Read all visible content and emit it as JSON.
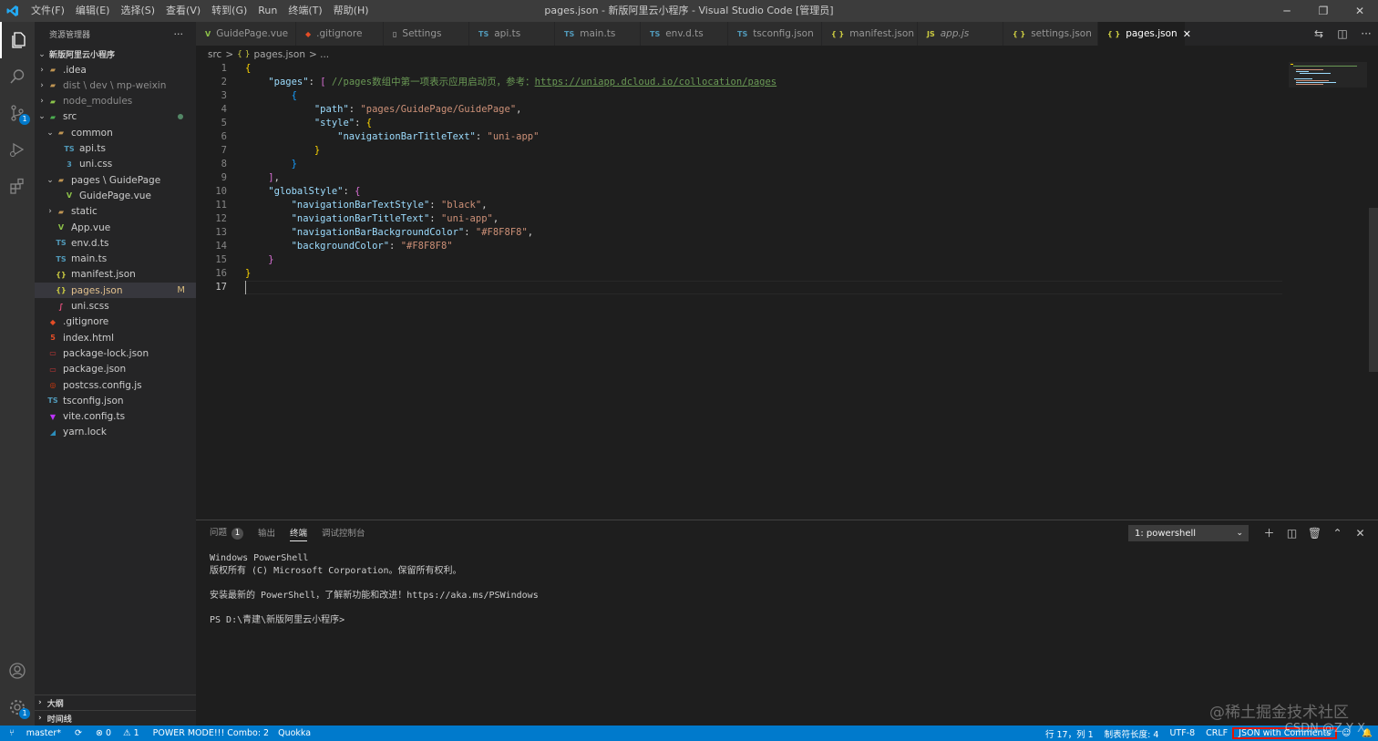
{
  "window": {
    "title": "pages.json - 新版阿里云小程序 - Visual Studio Code [管理员]",
    "menu": [
      "文件(F)",
      "编辑(E)",
      "选择(S)",
      "查看(V)",
      "转到(G)",
      "Run",
      "终端(T)",
      "帮助(H)"
    ]
  },
  "activity": {
    "scm_badge": "1",
    "settings_badge": "1"
  },
  "sidebar": {
    "title": "资源管理器",
    "more": "···",
    "root": "新版阿里云小程序",
    "items": [
      {
        "label": ".idea",
        "chev": "›",
        "icon": "▰",
        "icolor": "#c09553",
        "indent": 1
      },
      {
        "label": "dist \\ dev \\ mp-weixin",
        "chev": "›",
        "icon": "▰",
        "icolor": "#c09553",
        "indent": 1,
        "dim": true
      },
      {
        "label": "node_modules",
        "chev": "›",
        "icon": "▰",
        "icolor": "#8bc34a",
        "indent": 1,
        "dim": true
      },
      {
        "label": "src",
        "chev": "⌄",
        "icon": "▰",
        "icolor": "#4caf50",
        "indent": 1,
        "dot": true
      },
      {
        "label": "common",
        "chev": "⌄",
        "icon": "▰",
        "icolor": "#c09553",
        "indent": 2
      },
      {
        "label": "api.ts",
        "chev": "",
        "icon": "TS",
        "icolor": "#519aba",
        "indent": 3
      },
      {
        "label": "uni.css",
        "chev": "",
        "icon": "3",
        "icolor": "#519aba",
        "indent": 3
      },
      {
        "label": "pages \\ GuidePage",
        "chev": "⌄",
        "icon": "▰",
        "icolor": "#c09553",
        "indent": 2
      },
      {
        "label": "GuidePage.vue",
        "chev": "",
        "icon": "V",
        "icolor": "#8dc149",
        "indent": 3
      },
      {
        "label": "static",
        "chev": "›",
        "icon": "▰",
        "icolor": "#c09553",
        "indent": 2
      },
      {
        "label": "App.vue",
        "chev": "",
        "icon": "V",
        "icolor": "#8dc149",
        "indent": 2
      },
      {
        "label": "env.d.ts",
        "chev": "",
        "icon": "TS",
        "icolor": "#519aba",
        "indent": 2
      },
      {
        "label": "main.ts",
        "chev": "",
        "icon": "TS",
        "icolor": "#519aba",
        "indent": 2
      },
      {
        "label": "manifest.json",
        "chev": "",
        "icon": "{}",
        "icolor": "#cbcb41",
        "indent": 2
      },
      {
        "label": "pages.json",
        "chev": "",
        "icon": "{}",
        "icolor": "#cbcb41",
        "indent": 2,
        "selected": true,
        "mod": "M"
      },
      {
        "label": "uni.scss",
        "chev": "",
        "icon": "∫",
        "icolor": "#f55385",
        "indent": 2
      },
      {
        "label": ".gitignore",
        "chev": "",
        "icon": "◆",
        "icolor": "#e44d26",
        "indent": 1
      },
      {
        "label": "index.html",
        "chev": "",
        "icon": "5",
        "icolor": "#e44d26",
        "indent": 1
      },
      {
        "label": "package-lock.json",
        "chev": "",
        "icon": "▭",
        "icolor": "#cb3837",
        "indent": 1
      },
      {
        "label": "package.json",
        "chev": "",
        "icon": "▭",
        "icolor": "#cb3837",
        "indent": 1
      },
      {
        "label": "postcss.config.js",
        "chev": "",
        "icon": "◎",
        "icolor": "#dd3a0a",
        "indent": 1
      },
      {
        "label": "tsconfig.json",
        "chev": "",
        "icon": "TS",
        "icolor": "#519aba",
        "indent": 1
      },
      {
        "label": "vite.config.ts",
        "chev": "",
        "icon": "▼",
        "icolor": "#bd34fe",
        "indent": 1
      },
      {
        "label": "yarn.lock",
        "chev": "",
        "icon": "◢",
        "icolor": "#2c8ebb",
        "indent": 1
      }
    ],
    "outline": "大纲",
    "timeline": "时间线"
  },
  "tabs": [
    {
      "label": "GuidePage.vue",
      "icon": "V",
      "icolor": "#8dc149"
    },
    {
      "label": ".gitignore",
      "icon": "◆",
      "icolor": "#e44d26"
    },
    {
      "label": "Settings",
      "icon": "▯",
      "icolor": "#c5c5c5"
    },
    {
      "label": "api.ts",
      "icon": "TS",
      "icolor": "#519aba"
    },
    {
      "label": "main.ts",
      "icon": "TS",
      "icolor": "#519aba"
    },
    {
      "label": "env.d.ts",
      "icon": "TS",
      "icolor": "#519aba"
    },
    {
      "label": "tsconfig.json",
      "icon": "TS",
      "icolor": "#519aba"
    },
    {
      "label": "manifest.json",
      "icon": "{ }",
      "icolor": "#cbcb41"
    },
    {
      "label": "app.js",
      "icon": "JS",
      "icolor": "#cbcb41",
      "italic": true
    },
    {
      "label": "settings.json",
      "icon": "{ }",
      "icolor": "#cbcb41"
    },
    {
      "label": "pages.json",
      "icon": "{ }",
      "icolor": "#cbcb41",
      "active": true,
      "close": "✕"
    }
  ],
  "breadcrumb": {
    "folder": "src",
    "sep": ">",
    "icon": "{ }",
    "file": "pages.json",
    "rest": "> ..."
  },
  "editor": {
    "current_line": "17",
    "lines": [
      {
        "n": "1",
        "tokens": [
          {
            "t": "{",
            "c": "b1"
          }
        ]
      },
      {
        "n": "2",
        "tokens": [
          {
            "t": "    "
          },
          {
            "t": "\"pages\"",
            "c": "k"
          },
          {
            "t": ": ",
            "c": "p"
          },
          {
            "t": "[",
            "c": "b2"
          },
          {
            "t": " //pages数组中第一项表示应用启动页，参考：",
            "c": "c"
          },
          {
            "t": "https://uniapp.dcloud.io/collocation/pages",
            "c": "link"
          }
        ]
      },
      {
        "n": "3",
        "tokens": [
          {
            "t": "        "
          },
          {
            "t": "{",
            "c": "b3"
          }
        ]
      },
      {
        "n": "4",
        "tokens": [
          {
            "t": "            "
          },
          {
            "t": "\"path\"",
            "c": "k"
          },
          {
            "t": ": ",
            "c": "p"
          },
          {
            "t": "\"pages/GuidePage/GuidePage\"",
            "c": "s"
          },
          {
            "t": ",",
            "c": "p"
          }
        ]
      },
      {
        "n": "5",
        "tokens": [
          {
            "t": "            "
          },
          {
            "t": "\"style\"",
            "c": "k"
          },
          {
            "t": ": ",
            "c": "p"
          },
          {
            "t": "{",
            "c": "b1"
          }
        ]
      },
      {
        "n": "6",
        "tokens": [
          {
            "t": "                "
          },
          {
            "t": "\"navigationBarTitleText\"",
            "c": "k"
          },
          {
            "t": ": ",
            "c": "p"
          },
          {
            "t": "\"uni-app\"",
            "c": "s"
          }
        ]
      },
      {
        "n": "7",
        "tokens": [
          {
            "t": "            "
          },
          {
            "t": "}",
            "c": "b1"
          }
        ]
      },
      {
        "n": "8",
        "tokens": [
          {
            "t": "        "
          },
          {
            "t": "}",
            "c": "b3"
          }
        ]
      },
      {
        "n": "9",
        "tokens": [
          {
            "t": "    "
          },
          {
            "t": "]",
            "c": "b2"
          },
          {
            "t": ",",
            "c": "p"
          }
        ]
      },
      {
        "n": "10",
        "tokens": [
          {
            "t": "    "
          },
          {
            "t": "\"globalStyle\"",
            "c": "k"
          },
          {
            "t": ": ",
            "c": "p"
          },
          {
            "t": "{",
            "c": "b2"
          }
        ]
      },
      {
        "n": "11",
        "tokens": [
          {
            "t": "        "
          },
          {
            "t": "\"navigationBarTextStyle\"",
            "c": "k"
          },
          {
            "t": ": ",
            "c": "p"
          },
          {
            "t": "\"black\"",
            "c": "s"
          },
          {
            "t": ",",
            "c": "p"
          }
        ]
      },
      {
        "n": "12",
        "tokens": [
          {
            "t": "        "
          },
          {
            "t": "\"navigationBarTitleText\"",
            "c": "k"
          },
          {
            "t": ": ",
            "c": "p"
          },
          {
            "t": "\"uni-app\"",
            "c": "s"
          },
          {
            "t": ",",
            "c": "p"
          }
        ]
      },
      {
        "n": "13",
        "tokens": [
          {
            "t": "        "
          },
          {
            "t": "\"navigationBarBackgroundColor\"",
            "c": "k"
          },
          {
            "t": ": ",
            "c": "p"
          },
          {
            "t": "\"#F8F8F8\"",
            "c": "s"
          },
          {
            "t": ",",
            "c": "p"
          }
        ]
      },
      {
        "n": "14",
        "tokens": [
          {
            "t": "        "
          },
          {
            "t": "\"backgroundColor\"",
            "c": "k"
          },
          {
            "t": ": ",
            "c": "p"
          },
          {
            "t": "\"#F8F8F8\"",
            "c": "s"
          }
        ]
      },
      {
        "n": "15",
        "tokens": [
          {
            "t": "    "
          },
          {
            "t": "}",
            "c": "b2"
          }
        ]
      },
      {
        "n": "16",
        "tokens": [
          {
            "t": "}",
            "c": "b1"
          }
        ]
      },
      {
        "n": "17",
        "tokens": []
      }
    ]
  },
  "panel": {
    "tabs": [
      {
        "label": "问题",
        "badge": "1"
      },
      {
        "label": "输出"
      },
      {
        "label": "终端",
        "active": true
      },
      {
        "label": "调试控制台"
      }
    ],
    "terminal_select": "1: powershell",
    "terminal_lines": [
      "Windows PowerShell",
      "版权所有 (C) Microsoft Corporation。保留所有权利。",
      "",
      "安装最新的 PowerShell，了解新功能和改进！https://aka.ms/PSWindows",
      "",
      "PS D:\\青建\\新版阿里云小程序>"
    ],
    "watermark": "@稀土掘金技术社区"
  },
  "statusbar": {
    "branch": "master*",
    "errors": "⊗ 0",
    "warnings": "⚠ 1",
    "power_mode": "POWER MODE!!! Combo: 2",
    "quokka": "Quokka",
    "position": "行 17，列 1",
    "indent": "制表符长度: 4",
    "encoding": "UTF-8",
    "eol": "CRLF",
    "language": "JSON with Comments",
    "csdn": "CSDN @Z Y X"
  }
}
